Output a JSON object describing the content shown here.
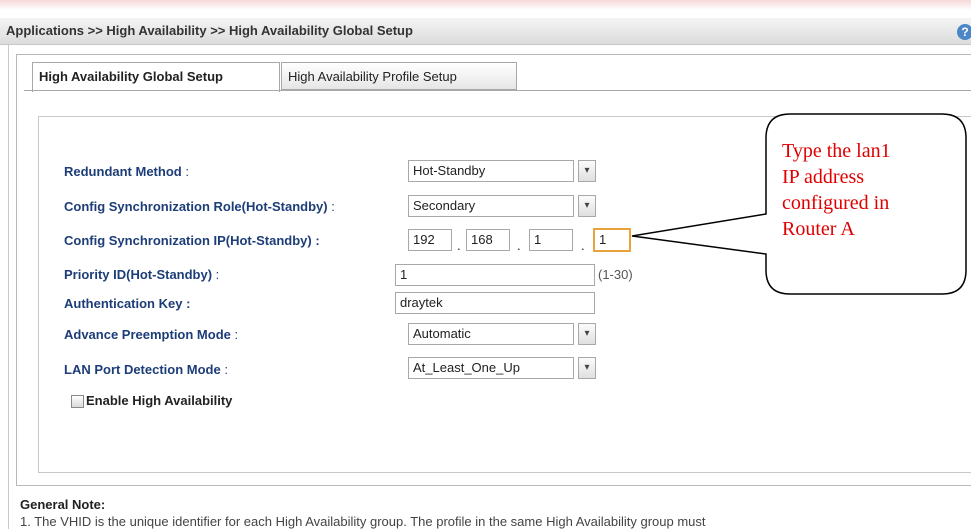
{
  "breadcrumb": "Applications >> High Availability >> High Availability Global Setup",
  "help_icon": "?",
  "tabs": [
    {
      "label": "High Availability Global Setup",
      "active": true
    },
    {
      "label": "High Availability Profile Setup",
      "active": false
    }
  ],
  "form": {
    "redundant_method": {
      "label": "Redundant Method",
      "suffix": " :",
      "value": "Hot-Standby"
    },
    "sync_role": {
      "label": "Config Synchronization Role(Hot-Standby)",
      "suffix": " :",
      "value": "Secondary"
    },
    "sync_ip": {
      "label": "Config Synchronization IP(Hot-Standby) :",
      "octets": [
        "192",
        "168",
        "1",
        "1"
      ],
      "dot": "."
    },
    "priority": {
      "label": "Priority ID(Hot-Standby)",
      "suffix": " :",
      "value": "1",
      "hint": "(1-30)"
    },
    "auth_key": {
      "label": "Authentication Key :",
      "value": "draytek"
    },
    "preemption": {
      "label": "Advance Preemption Mode",
      "suffix": " :",
      "value": "Automatic"
    },
    "lan_detection": {
      "label": "LAN Port Detection Mode",
      "suffix": " :",
      "value": "At_Least_One_Up"
    },
    "enable_ha": {
      "label": "Enable High Availability",
      "checked": false
    }
  },
  "callout": {
    "lines": [
      "Type the lan1",
      "IP address",
      "configured in",
      "Router A"
    ],
    "color": "#e00000"
  },
  "general_note": {
    "heading": "General Note:",
    "text": "1. The VHID is the unique identifier for each High Availability group. The profile in the same High Availability group must"
  },
  "icons": {
    "dropdown": "chevron-down-icon",
    "help": "help-icon"
  },
  "colors": {
    "label": "#1d3d78",
    "callout_text": "#e00000",
    "focus_border": "#e8a33a"
  }
}
